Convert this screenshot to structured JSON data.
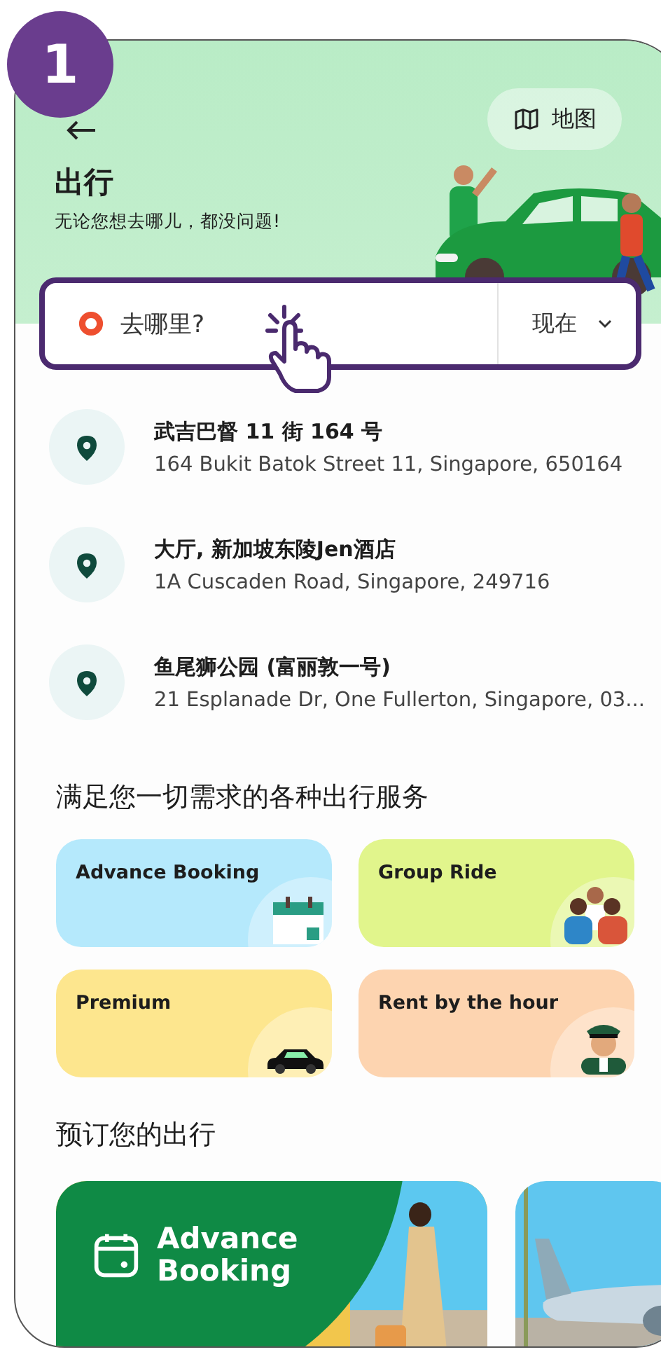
{
  "step_badge": "1",
  "header": {
    "title": "出行",
    "subtitle": "无论您想去哪儿，都没问题!",
    "map_button": "地图"
  },
  "search": {
    "placeholder": "去哪里?",
    "time": "现在"
  },
  "recent_places": [
    {
      "name": "武吉巴督 11 街 164 号",
      "address": "164 Bukit Batok Street 11, Singapore, 650164"
    },
    {
      "name": "大厅, 新加坡东陵Jen酒店",
      "address": "1A Cuscaden Road, Singapore, 249716"
    },
    {
      "name": "鱼尾狮公园 (富丽敦一号)",
      "address": "21 Esplanade Dr, One Fullerton, Singapore, 03..."
    }
  ],
  "services": {
    "title": "满足您一切需求的各种出行服务",
    "items": [
      {
        "label": "Advance Booking",
        "kind": "calendar",
        "color": "#b5e9fc"
      },
      {
        "label": "Group Ride",
        "kind": "group",
        "color": "#e1f58c"
      },
      {
        "label": "Premium",
        "kind": "car",
        "color": "#fde68e"
      },
      {
        "label": "Rent by the hour",
        "kind": "driver",
        "color": "#fdd4b0"
      }
    ]
  },
  "promos": {
    "title": "预订您的出行",
    "cards": [
      {
        "kind": "banner",
        "title": "Advance Booking"
      },
      {
        "kind": "picture"
      }
    ]
  }
}
